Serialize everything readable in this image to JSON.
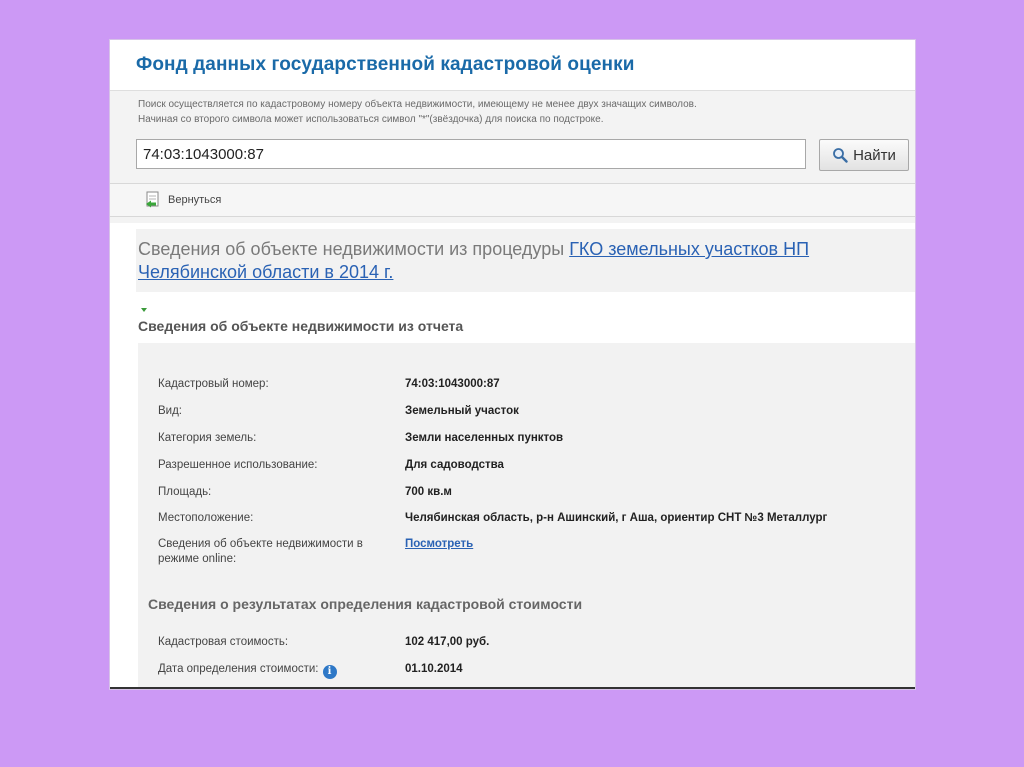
{
  "page": {
    "title": "Фонд данных государственной кадастровой оценки"
  },
  "search": {
    "hint_line1": "Поиск осуществляется по кадастровому номеру объекта недвижимости, имеющему не менее двух значащих символов.",
    "hint_line2": "Начиная со второго символа может использоваться символ \"*\"(звёздочка) для поиска по подстроке.",
    "value": "74:03:1043000:87",
    "button_label": "Найти",
    "button_icon": "magnifier-icon"
  },
  "toolbar": {
    "back_label": "Вернуться",
    "back_icon": "back-arrow-icon"
  },
  "info": {
    "heading_text": "Сведения об объекте недвижимости из процедуры ",
    "heading_link": "ГКО земельных участков НП Челябинской области в 2014 г."
  },
  "report": {
    "section_title": "Сведения об объекте недвижимости из отчета",
    "rows": [
      {
        "label": "Кадастровый номер:",
        "value": "74:03:1043000:87"
      },
      {
        "label": "Вид:",
        "value": "Земельный участок"
      },
      {
        "label": "Категория земель:",
        "value": "Земли населенных пунктов"
      },
      {
        "label": "Разрешенное использование:",
        "value": "Для садоводства"
      },
      {
        "label": "Площадь:",
        "value": "700 кв.м"
      },
      {
        "label": "Местоположение:",
        "value": "Челябинская область, р-н Ашинский, г Аша, ориентир СНТ №3 Металлург"
      },
      {
        "label": "Сведения об объекте недвижимости в режиме online:",
        "value": "Посмотреть"
      }
    ]
  },
  "cost": {
    "section_title": "Сведения о результатах определения кадастровой стоимости",
    "rows": [
      {
        "label": "Кадастровая стоимость:",
        "value": "102 417,00 руб."
      },
      {
        "label": "Дата определения стоимости:",
        "value": "01.10.2014"
      }
    ],
    "info_icon_glyph": "i"
  },
  "colors": {
    "background": "#cc99f5",
    "title": "#1a6aa8",
    "link": "#2a62b4"
  }
}
